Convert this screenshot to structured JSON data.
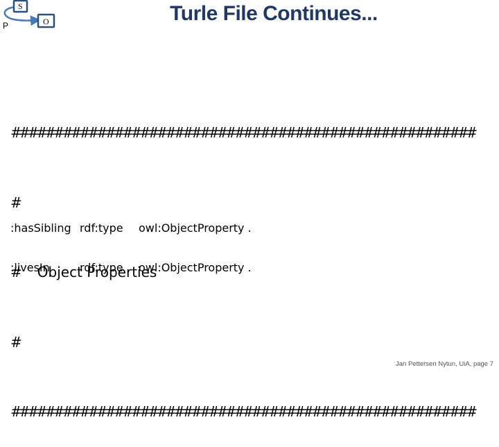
{
  "logo": {
    "subject_label": "S",
    "object_label": "O",
    "predicate_label": "P",
    "icon": "rdf-triple-icon"
  },
  "slide": {
    "title": "Turle File Continues...",
    "comment_block": {
      "hash_rule": "######################################################",
      "hash_single": "#",
      "heading_prefix": "#",
      "heading": "Object Properties"
    },
    "triples": [
      {
        "subject": ":hasSibling",
        "predicate": "rdf:type",
        "object": "owl:ObjectProperty ."
      },
      {
        "subject": ":livesIn",
        "predicate": "rdf:type",
        "object": "owl:ObjectProperty ."
      }
    ],
    "footer": "Jan Pettersen Nytun, UiA, page 7"
  },
  "colors": {
    "title": "#1f3864",
    "logo_stroke": "#2e4f7a",
    "logo_arc": "#4a7ab5"
  }
}
